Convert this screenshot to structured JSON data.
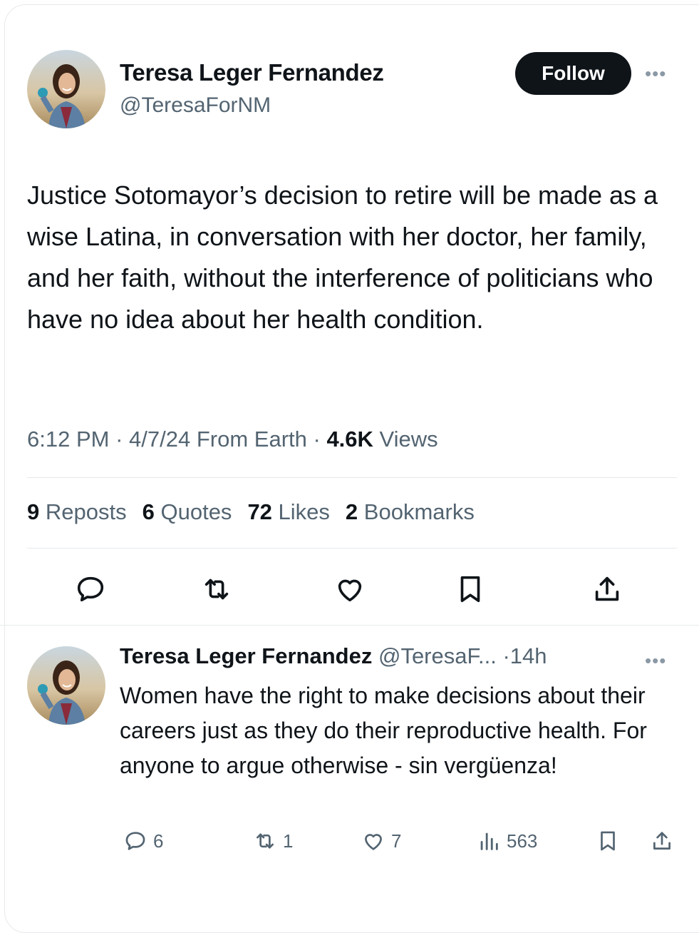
{
  "main_tweet": {
    "author_name": "Teresa Leger Fernandez",
    "handle": "@TeresaForNM",
    "follow_label": "Follow",
    "more_icon": "more-icon",
    "text": "Justice Sotomayor’s decision to retire will be made as a wise Latina, in conversation with her doctor, her family, and her faith, without the interference of politicians who have no idea about her health condition.",
    "time": "6:12 PM",
    "date": "4/7/24",
    "source": "From Earth",
    "views_count": "4.6K",
    "views_label": "Views",
    "stats": [
      {
        "count": "9",
        "label": "Reposts"
      },
      {
        "count": "6",
        "label": "Quotes"
      },
      {
        "count": "72",
        "label": "Likes"
      },
      {
        "count": "2",
        "label": "Bookmarks"
      }
    ],
    "actions": [
      "reply-icon",
      "repost-icon",
      "like-icon",
      "bookmark-icon",
      "share-icon"
    ]
  },
  "reply": {
    "author_name": "Teresa Leger Fernandez",
    "handle": "@TeresaF...",
    "age": "14h",
    "text": "Women have the right to make decisions about their careers just as they do their reproductive health. For anyone to argue otherwise - sin vergüenza!",
    "counts": {
      "replies": "6",
      "reposts": "1",
      "likes": "7",
      "views": "563"
    }
  },
  "colors": {
    "text_primary": "#0f1419",
    "text_secondary": "#536471",
    "button_bg": "#0f1419",
    "divider": "#e6e9ec"
  }
}
